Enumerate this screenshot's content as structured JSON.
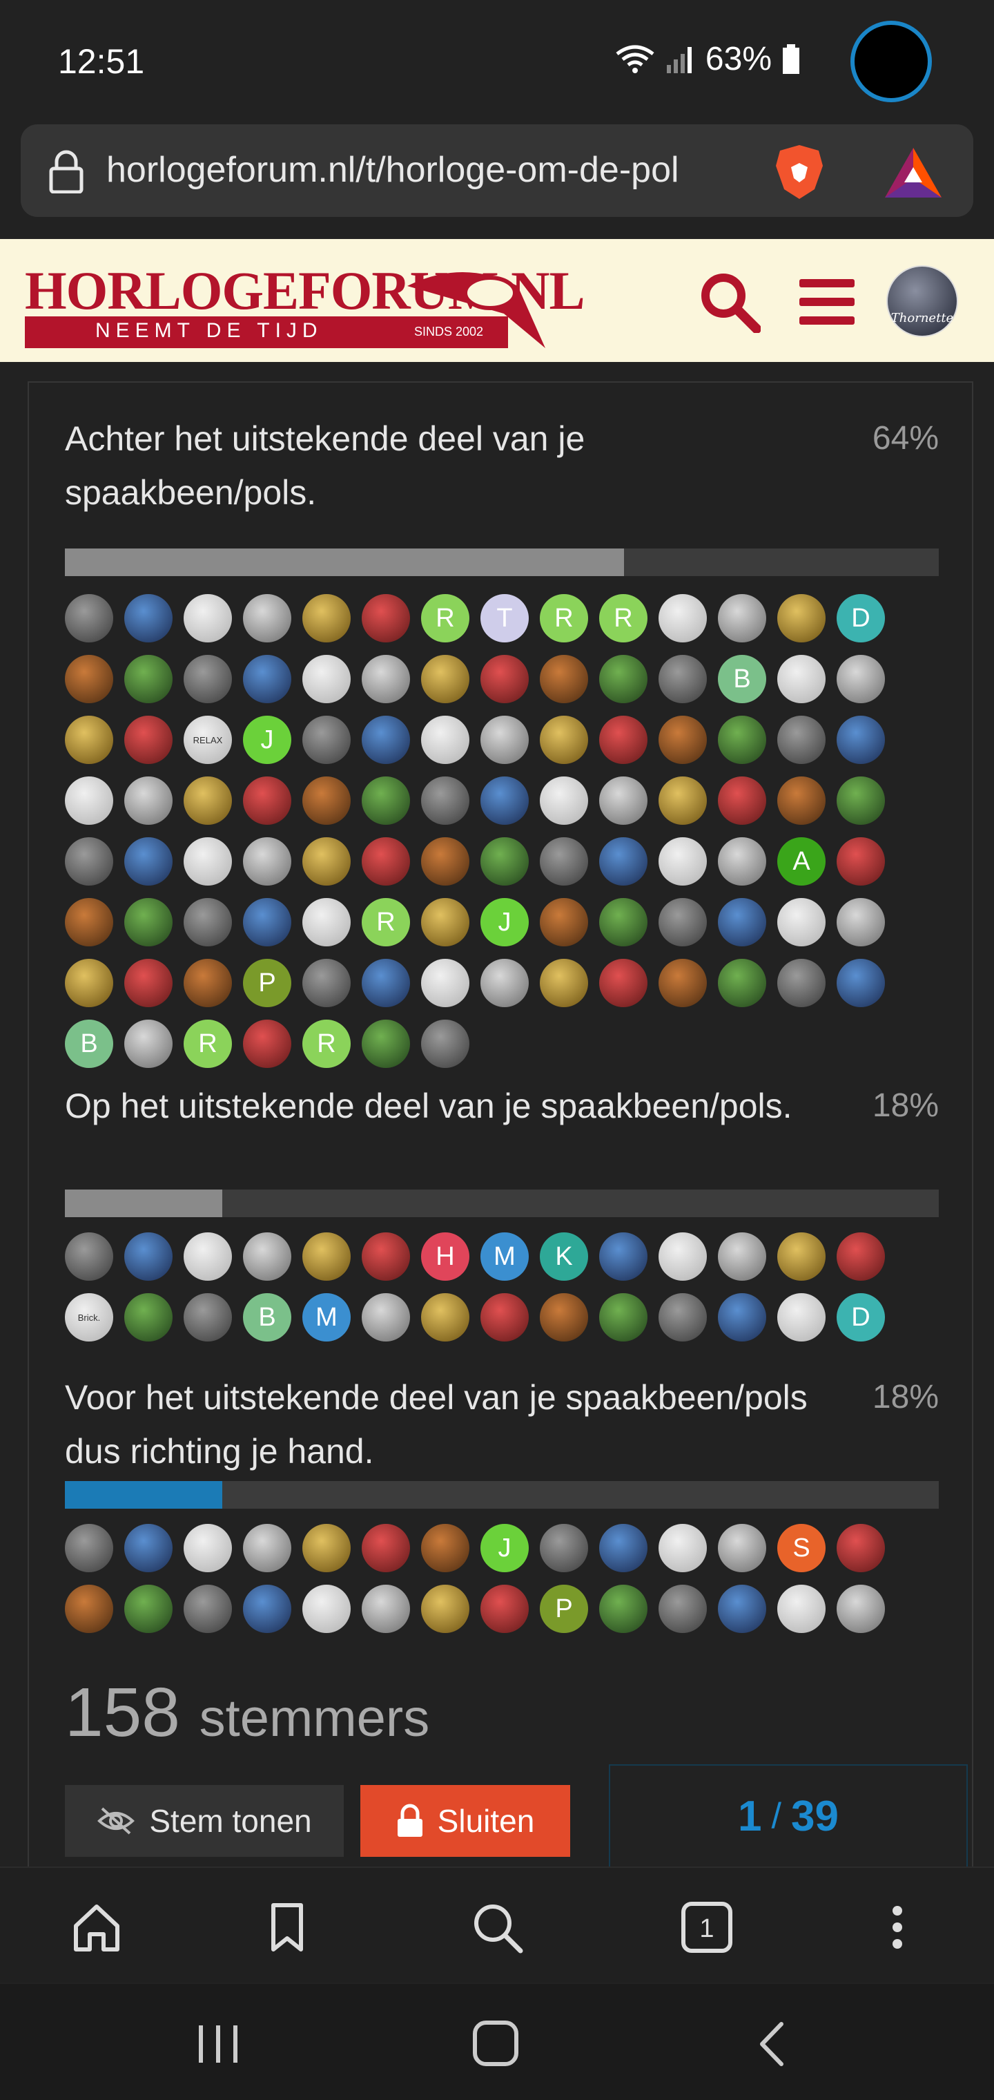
{
  "status_bar": {
    "time": "12:51",
    "battery": "63%"
  },
  "url_bar": {
    "url": "horlogeforum.nl/t/horloge-om-de-pol"
  },
  "site_header": {
    "logo_title": "HORLOGEFORUM.NL",
    "logo_subtitle": "NEEMT DE TIJD",
    "logo_since": "SINDS 2002",
    "user_avatar_label": "Thornette"
  },
  "poll": {
    "options": [
      {
        "text": "Achter het uitstekende deel van je spaakbeen/pols.",
        "percent": "64%",
        "fill": 64,
        "voters": [
          "",
          "",
          "",
          "",
          "",
          "",
          "R",
          "T",
          "R",
          "R",
          "",
          "",
          "",
          "D",
          "",
          "",
          "",
          "",
          "",
          "",
          "",
          "",
          "",
          "",
          "",
          "B",
          "",
          "",
          "",
          "",
          "RELAX",
          "J",
          "",
          "",
          "",
          "",
          "",
          "",
          "",
          "",
          "",
          "",
          "",
          "",
          "",
          "",
          "",
          "",
          "",
          "",
          "",
          "",
          "",
          "",
          "",
          "",
          "",
          "",
          "",
          "",
          "",
          "",
          "",
          "",
          "",
          "",
          "",
          "",
          "A",
          "",
          "",
          "",
          "",
          "",
          "",
          "R",
          "",
          "J",
          "",
          "",
          "",
          "",
          "",
          "",
          "",
          "",
          "",
          "P",
          "",
          "",
          "",
          "",
          "",
          "",
          "",
          "",
          "",
          "",
          "B",
          "",
          "R",
          "",
          "R",
          "",
          ""
        ]
      },
      {
        "text": "Op het uitstekende deel van je spaakbeen/pols.",
        "percent": "18%",
        "fill": 18,
        "voters": [
          "",
          "",
          "",
          "",
          "",
          "",
          "H",
          "M",
          "K",
          "",
          "",
          "",
          "",
          "",
          "Brick.",
          "",
          "",
          "B",
          "M",
          "",
          "",
          "",
          "",
          "",
          "",
          "",
          "",
          "D"
        ]
      },
      {
        "text": "Voor het uitstekende deel van je spaakbeen/pols dus richting je hand.",
        "percent": "18%",
        "fill": 18,
        "voters": [
          "",
          "",
          "",
          "",
          "",
          "",
          "",
          "J",
          "",
          "",
          "",
          "",
          "S",
          "",
          "",
          "",
          "",
          "",
          "",
          "",
          "",
          "",
          "P",
          "",
          "",
          "",
          "",
          ""
        ]
      }
    ],
    "voters_count": "158",
    "voters_label": "stemmers",
    "show_votes_label": "Stem tonen",
    "close_label": "Sluiten",
    "pager": {
      "current": "1",
      "total": "39"
    }
  },
  "colors": {
    "accent_red": "#b3142b",
    "progress_blue": "#1b7bb6",
    "close_button": "#e24a2a",
    "pager_blue": "#1b8ad0"
  }
}
